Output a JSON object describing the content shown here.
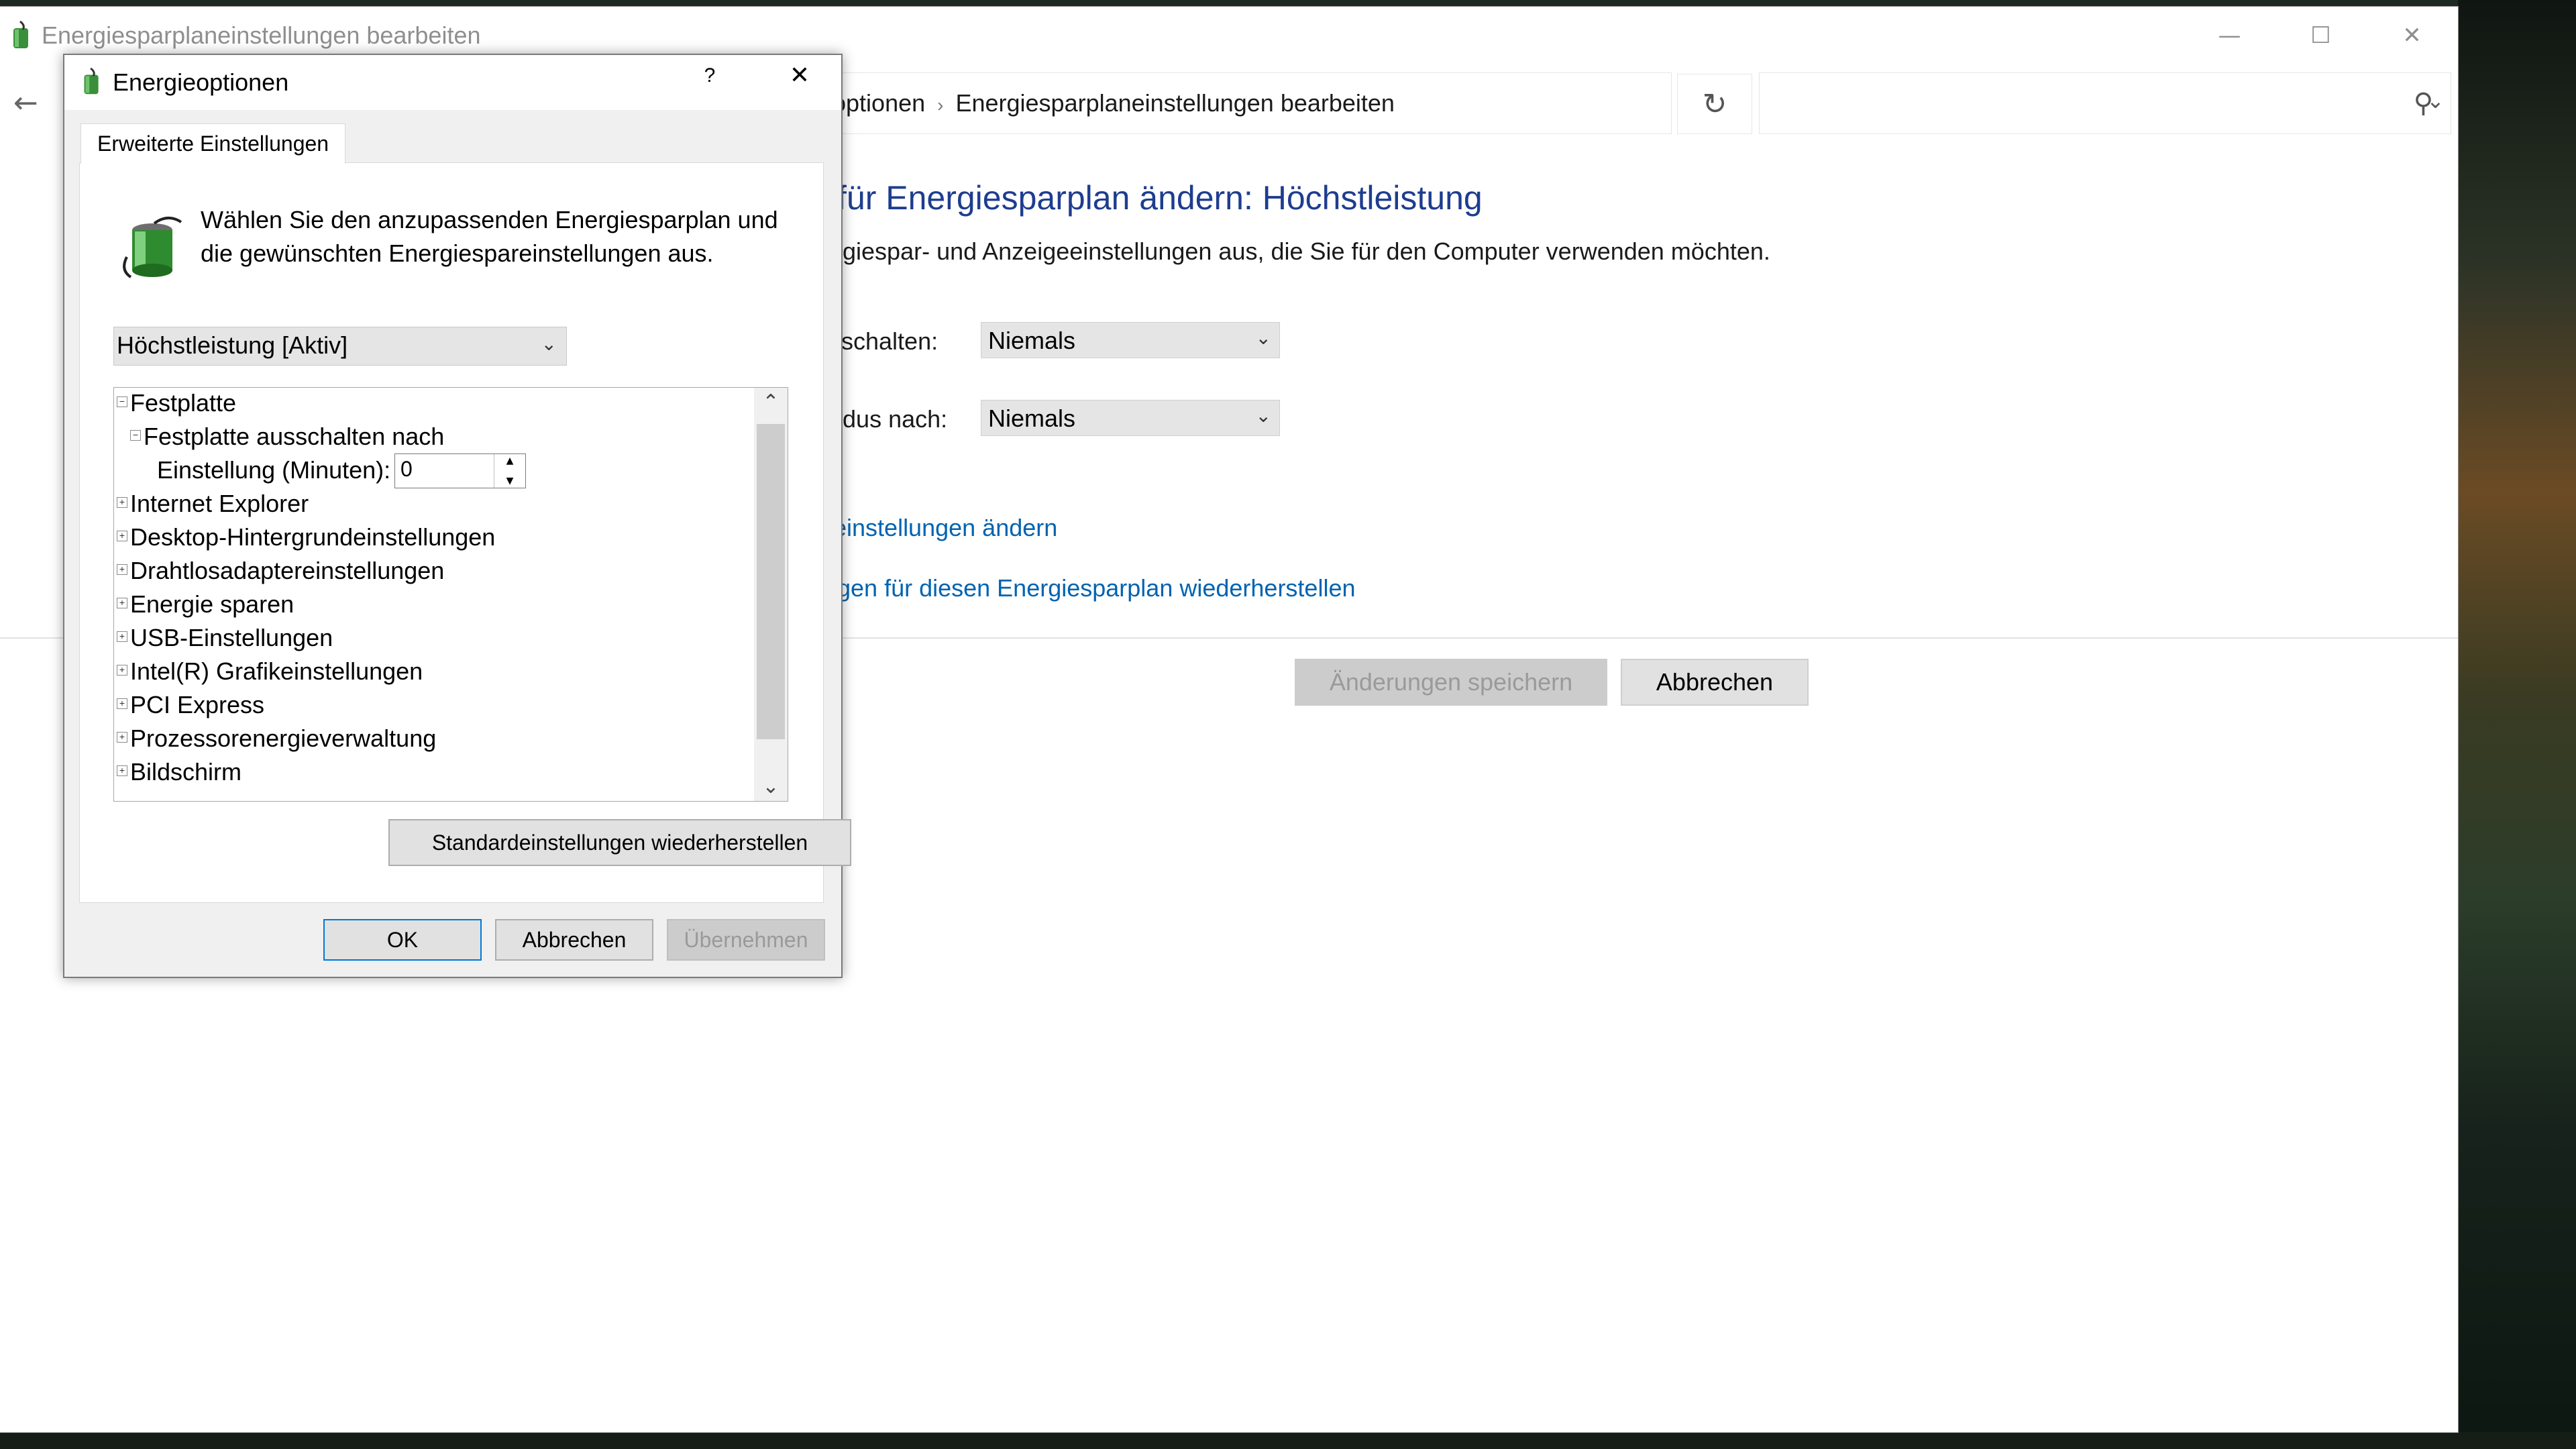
{
  "main_window": {
    "title": "Energiesparplaneinstellungen bearbeiten",
    "address": {
      "segment_1": "optionen",
      "segment_2": "Energiesparplaneinstellungen bearbeiten"
    },
    "heading": "für Energiesparplan ändern: Höchstleistung",
    "subtext": "ergiespar- und Anzeigeeinstellungen aus, die Sie für den Computer verwenden möchten.",
    "setting_rows": [
      {
        "label": "sschalten:",
        "value": "Niemals"
      },
      {
        "label": "odus nach:",
        "value": "Niemals"
      }
    ],
    "links": {
      "advanced": "einstellungen ändern",
      "restore": "gen für diesen Energiesparplan wiederherstellen"
    },
    "buttons": {
      "save": "Änderungen speichern",
      "cancel": "Abbrechen"
    }
  },
  "dialog": {
    "title": "Energieoptionen",
    "help": "?",
    "tab": "Erweiterte Einstellungen",
    "description": "Wählen Sie den anzupassenden Energiesparplan und die gewünschten Energiespareinstellungen aus.",
    "plan_selected": "Höchstleistung [Aktiv]",
    "tree": {
      "festplatte": "Festplatte",
      "festplatte_aus": "Festplatte ausschalten nach",
      "einstellung_label": "Einstellung (Minuten):",
      "einstellung_value": "0",
      "items": [
        "Internet Explorer",
        "Desktop-Hintergrundeinstellungen",
        "Drahtlosadaptereinstellungen",
        "Energie sparen",
        "USB-Einstellungen",
        "Intel(R) Grafikeinstellungen",
        "PCI Express",
        "Prozessorenergieverwaltung",
        "Bildschirm"
      ]
    },
    "restore_button": "Standardeinstellungen wiederherstellen",
    "ok": "OK",
    "cancel": "Abbrechen",
    "apply": "Übernehmen"
  }
}
